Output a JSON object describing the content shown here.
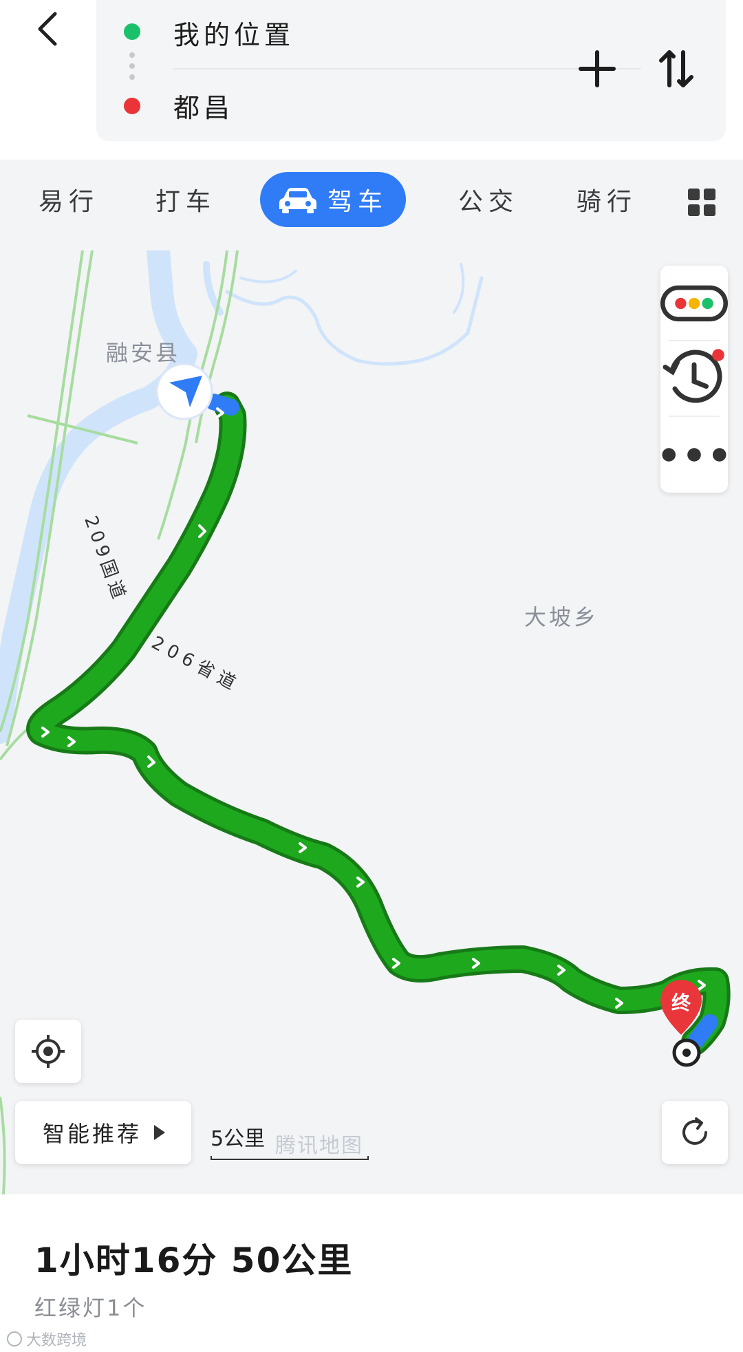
{
  "route": {
    "origin": "我的位置",
    "destination": "都昌"
  },
  "tabs": [
    {
      "label": "易行"
    },
    {
      "label": "打车"
    },
    {
      "label": "驾车",
      "active": true
    },
    {
      "label": "公交"
    },
    {
      "label": "骑行"
    }
  ],
  "map": {
    "places": {
      "county": "融安县",
      "town": "大坡乡"
    },
    "road_labels": {
      "national": "209国道",
      "provincial": "206省道"
    },
    "end_marker": "终",
    "scale_label": "5公里",
    "watermark": "腾讯地图",
    "smart_label": "智能推荐",
    "colors": {
      "route": "#1ea81e",
      "route_outline": "#177a17",
      "accent": "#2f7cf6",
      "river": "#cfe4fb",
      "road": "#a7dca0"
    }
  },
  "summary": {
    "duration_distance": "1小时16分  50公里",
    "traffic_lights": "红绿灯1个"
  },
  "footer": {
    "watermark": "大数跨境"
  },
  "icons": [
    "back-icon",
    "plus-icon",
    "swap-icon",
    "car-icon",
    "grid-icon",
    "traffic-icon",
    "history-icon",
    "more-icon",
    "locate-icon",
    "refresh-icon",
    "navigation-arrow-icon"
  ]
}
